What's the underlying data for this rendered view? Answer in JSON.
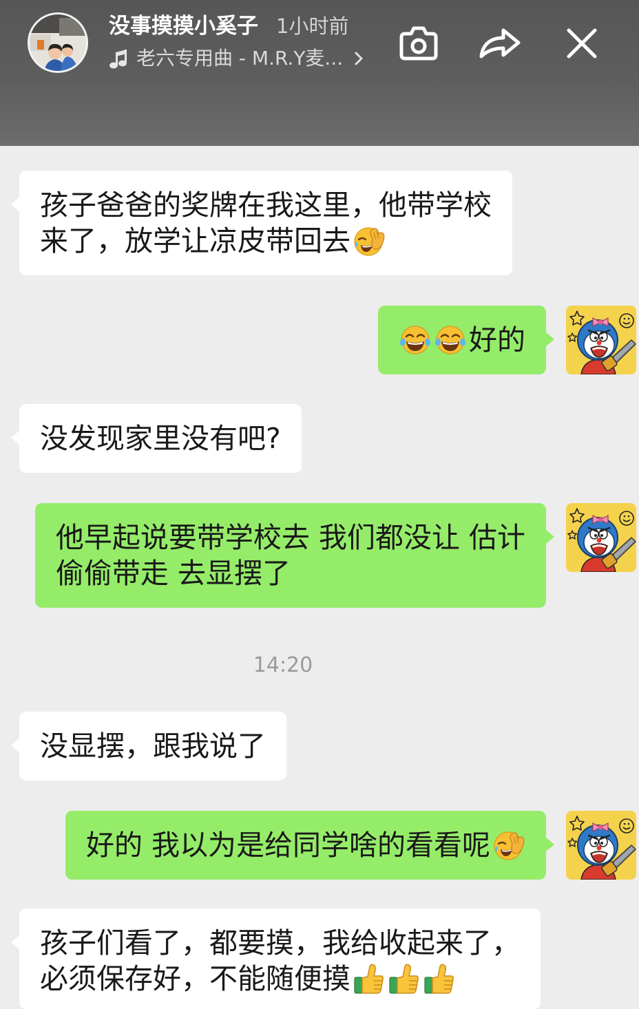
{
  "header": {
    "username": "没事摸摸小奚子",
    "time_ago": "1小时前",
    "music_title": "老六专用曲 - M.R.Y麦...",
    "icons": {
      "avatar": "poster-avatar-photo",
      "music": "music-note-icon",
      "music_more": "chevron-right-icon",
      "camera": "camera-icon",
      "share": "share-icon",
      "close": "close-icon"
    }
  },
  "colors": {
    "header_bg": "#565656",
    "chat_bg": "#ededed",
    "received_bubble": "#ffffff",
    "sent_bubble": "#95ec69",
    "message_text": "#191919",
    "time_divider_text": "#9a9a9a"
  },
  "chat": {
    "sent_avatar": "doraemon-avatar-icon",
    "time_divider": "14:20",
    "messages": [
      {
        "outgoing": false,
        "lines": [
          "孩子爸爸的奖牌在我这里，他带学校",
          "来了，放学让凉皮带回去"
        ],
        "emojis_after": [
          "facepalm-emoji-icon"
        ]
      },
      {
        "outgoing": true,
        "lines": [
          "好的"
        ],
        "emojis_before": [
          "tears-of-joy-emoji-icon",
          "tears-of-joy-emoji-icon"
        ]
      },
      {
        "outgoing": false,
        "lines": [
          "没发现家里没有吧?"
        ]
      },
      {
        "outgoing": true,
        "lines": [
          "他早起说要带学校去 我们都没让 估计",
          "偷偷带走 去显摆了"
        ]
      },
      {
        "outgoing": false,
        "lines": [
          "没显摆，跟我说了"
        ]
      },
      {
        "outgoing": true,
        "lines": [
          "好的 我以为是给同学啥的看看呢"
        ],
        "emojis_after": [
          "facepalm-emoji-icon"
        ]
      },
      {
        "outgoing": false,
        "lines": [
          "孩子们看了，都要摸，我给收起来了，",
          "必须保存好，不能随便摸"
        ],
        "emojis_after": [
          "thumbs-up-emoji-icon",
          "thumbs-up-emoji-icon",
          "thumbs-up-emoji-icon"
        ]
      }
    ]
  }
}
